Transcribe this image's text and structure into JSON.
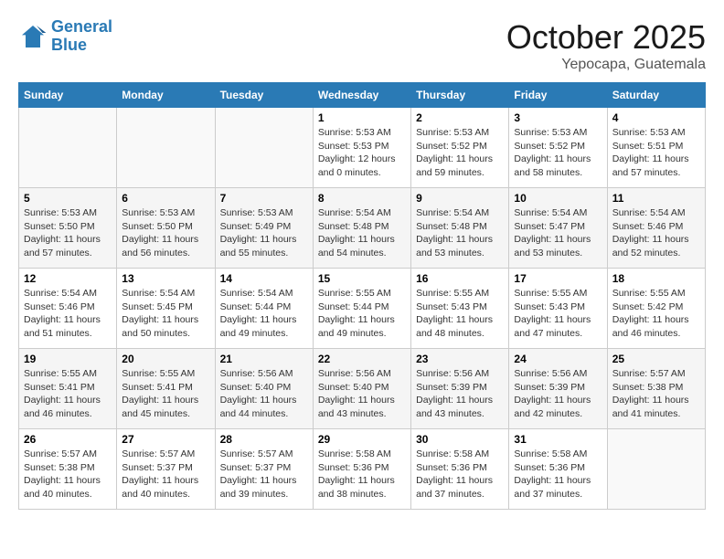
{
  "header": {
    "logo_line1": "General",
    "logo_line2": "Blue",
    "month": "October 2025",
    "location": "Yepocapa, Guatemala"
  },
  "weekdays": [
    "Sunday",
    "Monday",
    "Tuesday",
    "Wednesday",
    "Thursday",
    "Friday",
    "Saturday"
  ],
  "weeks": [
    [
      {
        "day": "",
        "info": ""
      },
      {
        "day": "",
        "info": ""
      },
      {
        "day": "",
        "info": ""
      },
      {
        "day": "1",
        "info": "Sunrise: 5:53 AM\nSunset: 5:53 PM\nDaylight: 12 hours\nand 0 minutes."
      },
      {
        "day": "2",
        "info": "Sunrise: 5:53 AM\nSunset: 5:52 PM\nDaylight: 11 hours\nand 59 minutes."
      },
      {
        "day": "3",
        "info": "Sunrise: 5:53 AM\nSunset: 5:52 PM\nDaylight: 11 hours\nand 58 minutes."
      },
      {
        "day": "4",
        "info": "Sunrise: 5:53 AM\nSunset: 5:51 PM\nDaylight: 11 hours\nand 57 minutes."
      }
    ],
    [
      {
        "day": "5",
        "info": "Sunrise: 5:53 AM\nSunset: 5:50 PM\nDaylight: 11 hours\nand 57 minutes."
      },
      {
        "day": "6",
        "info": "Sunrise: 5:53 AM\nSunset: 5:50 PM\nDaylight: 11 hours\nand 56 minutes."
      },
      {
        "day": "7",
        "info": "Sunrise: 5:53 AM\nSunset: 5:49 PM\nDaylight: 11 hours\nand 55 minutes."
      },
      {
        "day": "8",
        "info": "Sunrise: 5:54 AM\nSunset: 5:48 PM\nDaylight: 11 hours\nand 54 minutes."
      },
      {
        "day": "9",
        "info": "Sunrise: 5:54 AM\nSunset: 5:48 PM\nDaylight: 11 hours\nand 53 minutes."
      },
      {
        "day": "10",
        "info": "Sunrise: 5:54 AM\nSunset: 5:47 PM\nDaylight: 11 hours\nand 53 minutes."
      },
      {
        "day": "11",
        "info": "Sunrise: 5:54 AM\nSunset: 5:46 PM\nDaylight: 11 hours\nand 52 minutes."
      }
    ],
    [
      {
        "day": "12",
        "info": "Sunrise: 5:54 AM\nSunset: 5:46 PM\nDaylight: 11 hours\nand 51 minutes."
      },
      {
        "day": "13",
        "info": "Sunrise: 5:54 AM\nSunset: 5:45 PM\nDaylight: 11 hours\nand 50 minutes."
      },
      {
        "day": "14",
        "info": "Sunrise: 5:54 AM\nSunset: 5:44 PM\nDaylight: 11 hours\nand 49 minutes."
      },
      {
        "day": "15",
        "info": "Sunrise: 5:55 AM\nSunset: 5:44 PM\nDaylight: 11 hours\nand 49 minutes."
      },
      {
        "day": "16",
        "info": "Sunrise: 5:55 AM\nSunset: 5:43 PM\nDaylight: 11 hours\nand 48 minutes."
      },
      {
        "day": "17",
        "info": "Sunrise: 5:55 AM\nSunset: 5:43 PM\nDaylight: 11 hours\nand 47 minutes."
      },
      {
        "day": "18",
        "info": "Sunrise: 5:55 AM\nSunset: 5:42 PM\nDaylight: 11 hours\nand 46 minutes."
      }
    ],
    [
      {
        "day": "19",
        "info": "Sunrise: 5:55 AM\nSunset: 5:41 PM\nDaylight: 11 hours\nand 46 minutes."
      },
      {
        "day": "20",
        "info": "Sunrise: 5:55 AM\nSunset: 5:41 PM\nDaylight: 11 hours\nand 45 minutes."
      },
      {
        "day": "21",
        "info": "Sunrise: 5:56 AM\nSunset: 5:40 PM\nDaylight: 11 hours\nand 44 minutes."
      },
      {
        "day": "22",
        "info": "Sunrise: 5:56 AM\nSunset: 5:40 PM\nDaylight: 11 hours\nand 43 minutes."
      },
      {
        "day": "23",
        "info": "Sunrise: 5:56 AM\nSunset: 5:39 PM\nDaylight: 11 hours\nand 43 minutes."
      },
      {
        "day": "24",
        "info": "Sunrise: 5:56 AM\nSunset: 5:39 PM\nDaylight: 11 hours\nand 42 minutes."
      },
      {
        "day": "25",
        "info": "Sunrise: 5:57 AM\nSunset: 5:38 PM\nDaylight: 11 hours\nand 41 minutes."
      }
    ],
    [
      {
        "day": "26",
        "info": "Sunrise: 5:57 AM\nSunset: 5:38 PM\nDaylight: 11 hours\nand 40 minutes."
      },
      {
        "day": "27",
        "info": "Sunrise: 5:57 AM\nSunset: 5:37 PM\nDaylight: 11 hours\nand 40 minutes."
      },
      {
        "day": "28",
        "info": "Sunrise: 5:57 AM\nSunset: 5:37 PM\nDaylight: 11 hours\nand 39 minutes."
      },
      {
        "day": "29",
        "info": "Sunrise: 5:58 AM\nSunset: 5:36 PM\nDaylight: 11 hours\nand 38 minutes."
      },
      {
        "day": "30",
        "info": "Sunrise: 5:58 AM\nSunset: 5:36 PM\nDaylight: 11 hours\nand 37 minutes."
      },
      {
        "day": "31",
        "info": "Sunrise: 5:58 AM\nSunset: 5:36 PM\nDaylight: 11 hours\nand 37 minutes."
      },
      {
        "day": "",
        "info": ""
      }
    ]
  ]
}
